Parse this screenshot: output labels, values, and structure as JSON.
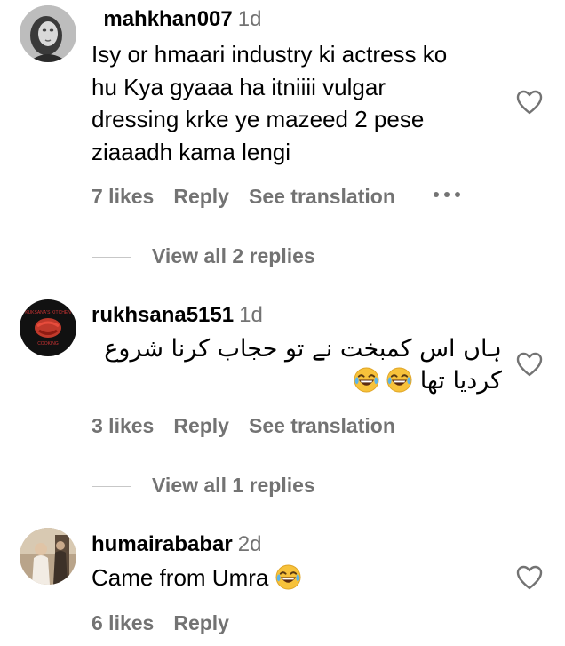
{
  "comments": [
    {
      "username": "_mahkhan007",
      "time": "1d",
      "text": "Isy or hmaari industry ki actress ko hu Kya gyaaa ha itniiii vulgar dressing krke ye mazeed 2 pese ziaaadh kama lengi",
      "likes": "7 likes",
      "reply": "Reply",
      "translate": "See translation",
      "view_replies": "View all 2 replies"
    },
    {
      "username": "rukhsana5151",
      "time": "1d",
      "text": "ہاں اس کمبخت نے تو حجاب کرنا شروع کردیا تھا",
      "emojis": [
        "face-with-tears-of-joy",
        "face-with-tears-of-joy"
      ],
      "likes": "3 likes",
      "reply": "Reply",
      "translate": "See translation",
      "view_replies": "View all 1 replies"
    },
    {
      "username": "humairababar",
      "time": "2d",
      "text": "Came from Umra",
      "emojis": [
        "face-with-tears-of-joy"
      ],
      "likes": "6 likes",
      "reply": "Reply"
    }
  ],
  "icons": {
    "like": "heart-outline-icon",
    "more": "more-options-icon",
    "emoji": "face-with-tears-of-joy"
  },
  "colors": {
    "secondary_text": "#737373",
    "primary_text": "#000000",
    "emoji_face": "#f7c23b"
  }
}
